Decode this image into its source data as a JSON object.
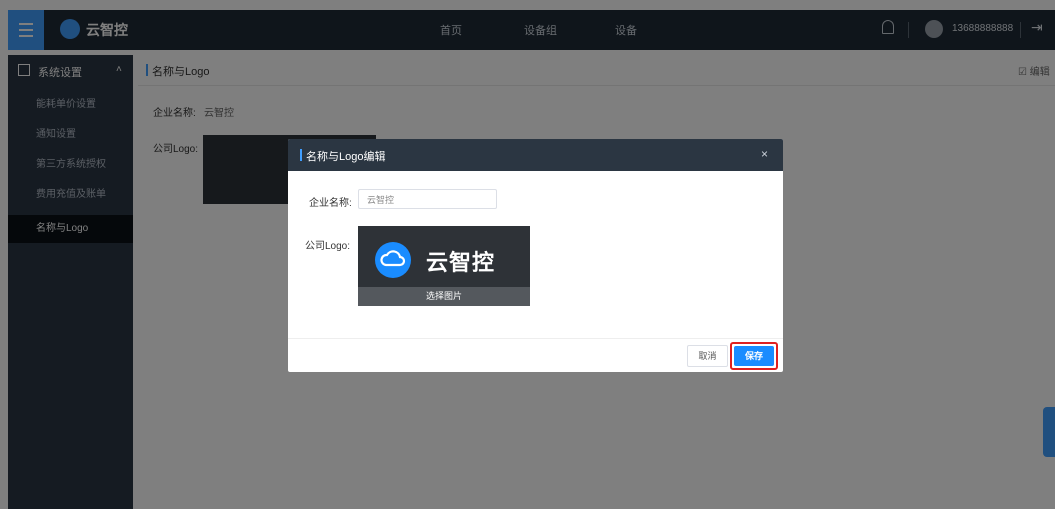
{
  "header": {
    "brand": "云智控",
    "nav": [
      "首页",
      "设备组",
      "设备"
    ],
    "phone": "13688888888",
    "logout_glyph": "⇥"
  },
  "sidebar": {
    "title": "系统设置",
    "caret": "˄",
    "items": [
      {
        "label": "能耗单价设置"
      },
      {
        "label": "通知设置"
      },
      {
        "label": "第三方系统授权"
      },
      {
        "label": "费用充值及账单"
      },
      {
        "label": "名称与Logo"
      }
    ]
  },
  "content": {
    "title": "名称与Logo",
    "edit_label": "☑ 编辑",
    "company_label": "企业名称:",
    "company_value": "云智控",
    "logo_label": "公司Logo:"
  },
  "modal": {
    "title": "名称与Logo编辑",
    "close": "×",
    "name_label": "企业名称:",
    "name_value": "云智控",
    "logo_label": "公司Logo:",
    "logo_text": "云智控",
    "choose_image": "选择图片",
    "cancel": "取消",
    "save": "保存"
  },
  "colors": {
    "accent": "#1a8cff",
    "topbar": "#1e2a37",
    "sidebar": "#2b3644",
    "highlight": "#e02020"
  }
}
